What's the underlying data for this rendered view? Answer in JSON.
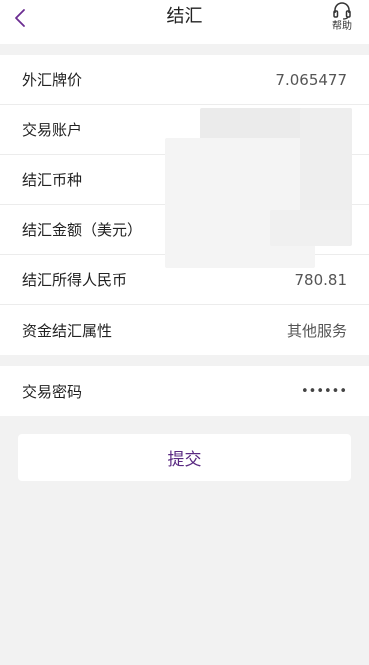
{
  "header": {
    "title": "结汇",
    "help_label": "帮助"
  },
  "form": {
    "rows": [
      {
        "label": "外汇牌价",
        "value": "7.065477"
      },
      {
        "label": "交易账户",
        "value": ""
      },
      {
        "label": "结汇币种",
        "value": ""
      },
      {
        "label": "结汇金额（美元）",
        "value": ""
      },
      {
        "label": "结汇所得人民币",
        "value": "780.81"
      },
      {
        "label": "资金结汇属性",
        "value": "其他服务"
      }
    ],
    "password": {
      "label": "交易密码",
      "value": "••••••"
    }
  },
  "submit_label": "提交",
  "colors": {
    "accent": "#6b2c91",
    "background": "#f2f2f2"
  }
}
